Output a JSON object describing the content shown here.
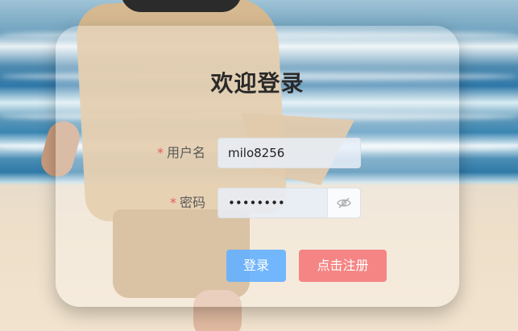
{
  "login": {
    "title": "欢迎登录",
    "required_mark": "*",
    "username": {
      "label": "用户名",
      "value": "milo8256"
    },
    "password": {
      "label": "密码",
      "masked_value": "••••••••",
      "toggle_icon": "eye-off-icon"
    },
    "buttons": {
      "login_label": "登录",
      "register_label": "点击注册"
    }
  },
  "colors": {
    "login_button": "#66b1ff",
    "register_button": "#f57a7a",
    "required_mark": "#e55b5b"
  }
}
